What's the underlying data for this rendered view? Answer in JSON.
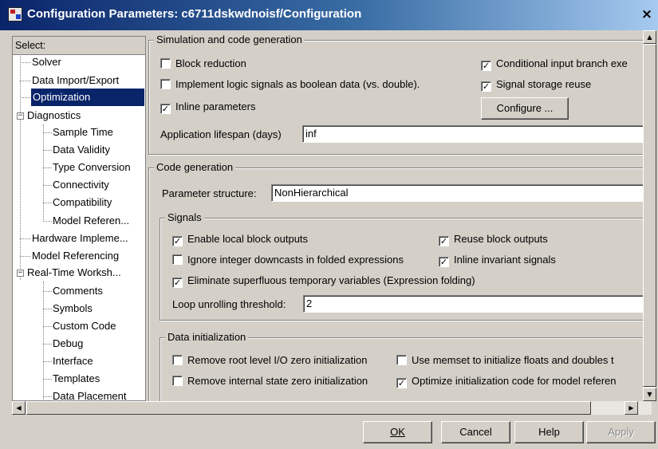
{
  "window": {
    "title": "Configuration Parameters: c6711dskwdnoisf/Configuration",
    "close_label": "×"
  },
  "tree": {
    "header": "Select:",
    "nodes": [
      {
        "label": "Solver"
      },
      {
        "label": "Data Import/Export"
      },
      {
        "label": "Optimization"
      },
      {
        "label": "Diagnostics"
      },
      {
        "label": "Sample Time"
      },
      {
        "label": "Data Validity"
      },
      {
        "label": "Type Conversion"
      },
      {
        "label": "Connectivity"
      },
      {
        "label": "Compatibility"
      },
      {
        "label": "Model Referen..."
      },
      {
        "label": "Hardware Impleme..."
      },
      {
        "label": "Model Referencing"
      },
      {
        "label": "Real-Time Worksh..."
      },
      {
        "label": "Comments"
      },
      {
        "label": "Symbols"
      },
      {
        "label": "Custom Code"
      },
      {
        "label": "Debug"
      },
      {
        "label": "Interface"
      },
      {
        "label": "Templates"
      },
      {
        "label": "Data Placement"
      }
    ],
    "collapse_glyph": "−"
  },
  "simulation": {
    "group_label": "Simulation and code generation",
    "block_reduction": {
      "label": "Block reduction",
      "checked": false
    },
    "implement_logic": {
      "label": "Implement logic signals as boolean data (vs. double).",
      "checked": false
    },
    "inline_params": {
      "label": "Inline parameters",
      "checked": true
    },
    "conditional_input": {
      "label": "Conditional input branch exe",
      "checked": true
    },
    "signal_storage": {
      "label": "Signal storage reuse",
      "checked": true
    },
    "configure_button": "Configure ...",
    "lifespan_label": "Application lifespan (days)",
    "lifespan_value": "inf"
  },
  "codegen": {
    "group_label": "Code generation",
    "param_structure_label": "Parameter structure:",
    "param_structure_value": "NonHierarchical",
    "signals": {
      "group_label": "Signals",
      "enable_local": {
        "label": "Enable local block outputs",
        "checked": true
      },
      "reuse_block": {
        "label": "Reuse block outputs",
        "checked": true
      },
      "ignore_integer": {
        "label": "Ignore integer downcasts in folded expressions",
        "checked": false
      },
      "inline_invariant": {
        "label": "Inline invariant signals",
        "checked": true
      },
      "eliminate_superfluous": {
        "label": "Eliminate superfluous temporary variables (Expression folding)",
        "checked": true
      },
      "loop_unroll_label": "Loop unrolling threshold:",
      "loop_unroll_value": "2"
    },
    "data_init": {
      "group_label": "Data initialization",
      "remove_root": {
        "label": "Remove root level I/O zero initialization",
        "checked": false
      },
      "use_memset": {
        "label": "Use memset to initialize floats and doubles t",
        "checked": false
      },
      "remove_internal": {
        "label": "Remove internal state zero initialization",
        "checked": false
      },
      "optimize_init": {
        "label": "Optimize initialization code for model referen",
        "checked": true
      }
    }
  },
  "buttons": {
    "ok": "OK",
    "cancel": "Cancel",
    "help": "Help",
    "apply": "Apply"
  },
  "glyphs": {
    "check": "✓",
    "up": "▲",
    "down": "▼",
    "left": "◀",
    "right": "▶"
  }
}
